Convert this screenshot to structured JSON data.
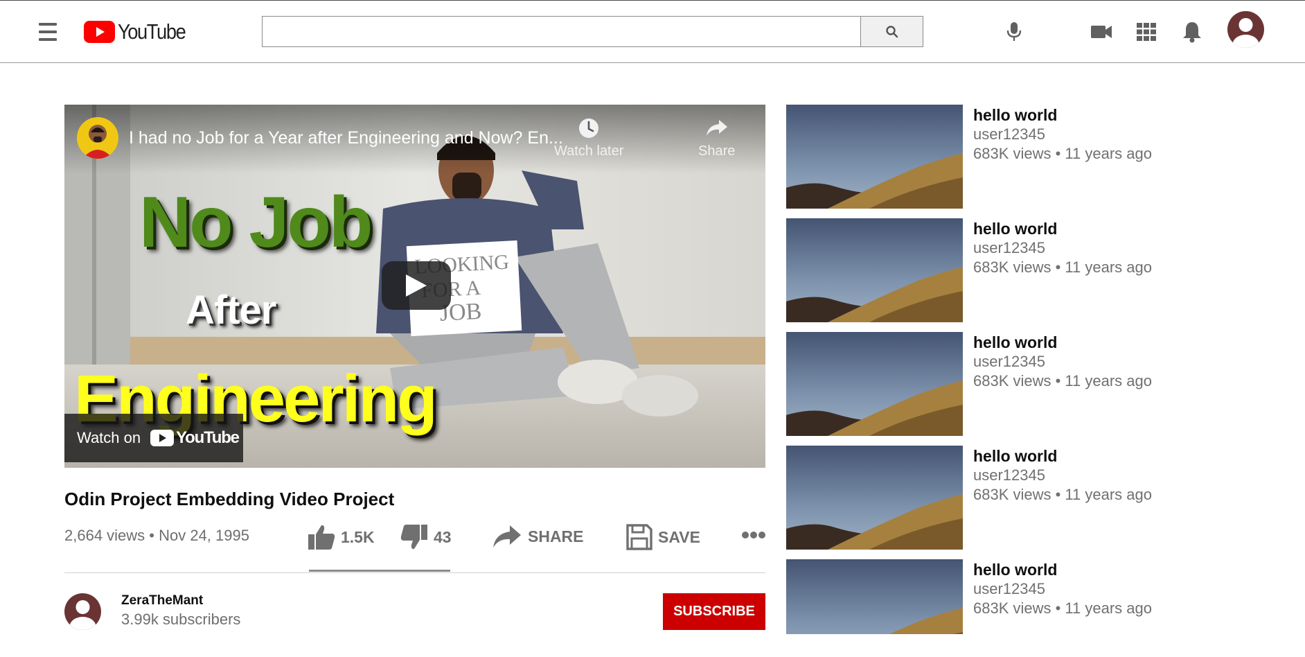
{
  "header": {
    "logo_text": "YouTube",
    "search": {
      "value": "",
      "placeholder": ""
    }
  },
  "player": {
    "overlay_title": "I had no Job for a Year after Engineering and Now? En...",
    "watch_later_label": "Watch later",
    "share_label": "Share",
    "watch_on_label": "Watch on",
    "watch_on_logo_text": "YouTube",
    "thumbnail_text": {
      "line1": "No Job",
      "line2": "After",
      "line3": "Engineering",
      "sign": "LOOKING FOR A JOB"
    }
  },
  "video": {
    "title": "Odin Project Embedding Video Project",
    "meta": "2,664 views • Nov 24, 1995",
    "likes": "1.5K",
    "dislikes": "43",
    "share_label": "SHARE",
    "save_label": "SAVE",
    "like_ratio": 0.97
  },
  "channel": {
    "name": "ZeraTheMant",
    "subscribers": "3.99k subscribers",
    "subscribe_label": "SUBSCRIBE"
  },
  "recommendations": [
    {
      "title": "hello world",
      "channel": "user12345",
      "meta": "683K views • 11 years ago"
    },
    {
      "title": "hello world",
      "channel": "user12345",
      "meta": "683K views • 11 years ago"
    },
    {
      "title": "hello world",
      "channel": "user12345",
      "meta": "683K views • 11 years ago"
    },
    {
      "title": "hello world",
      "channel": "user12345",
      "meta": "683K views • 11 years ago"
    },
    {
      "title": "hello world",
      "channel": "user12345",
      "meta": "683K views • 11 years ago"
    }
  ],
  "colors": {
    "brand_red": "#ff0000",
    "subscribe_red": "#cc0000",
    "icon_gray": "#606060",
    "thumb_green": "#4f8a1b",
    "thumb_yellow": "#ffff1e"
  },
  "icons": {
    "menu": "hamburger-menu-icon",
    "search": "magnifier-icon",
    "mic": "microphone-icon",
    "create": "video-camera-icon",
    "apps": "grid-apps-icon",
    "notifications": "bell-icon",
    "like": "thumbs-up-icon",
    "dislike": "thumbs-down-icon",
    "share": "share-arrow-icon",
    "save": "floppy-disk-icon",
    "more": "more-dots-icon",
    "watch_later": "clock-icon",
    "play": "play-icon"
  }
}
